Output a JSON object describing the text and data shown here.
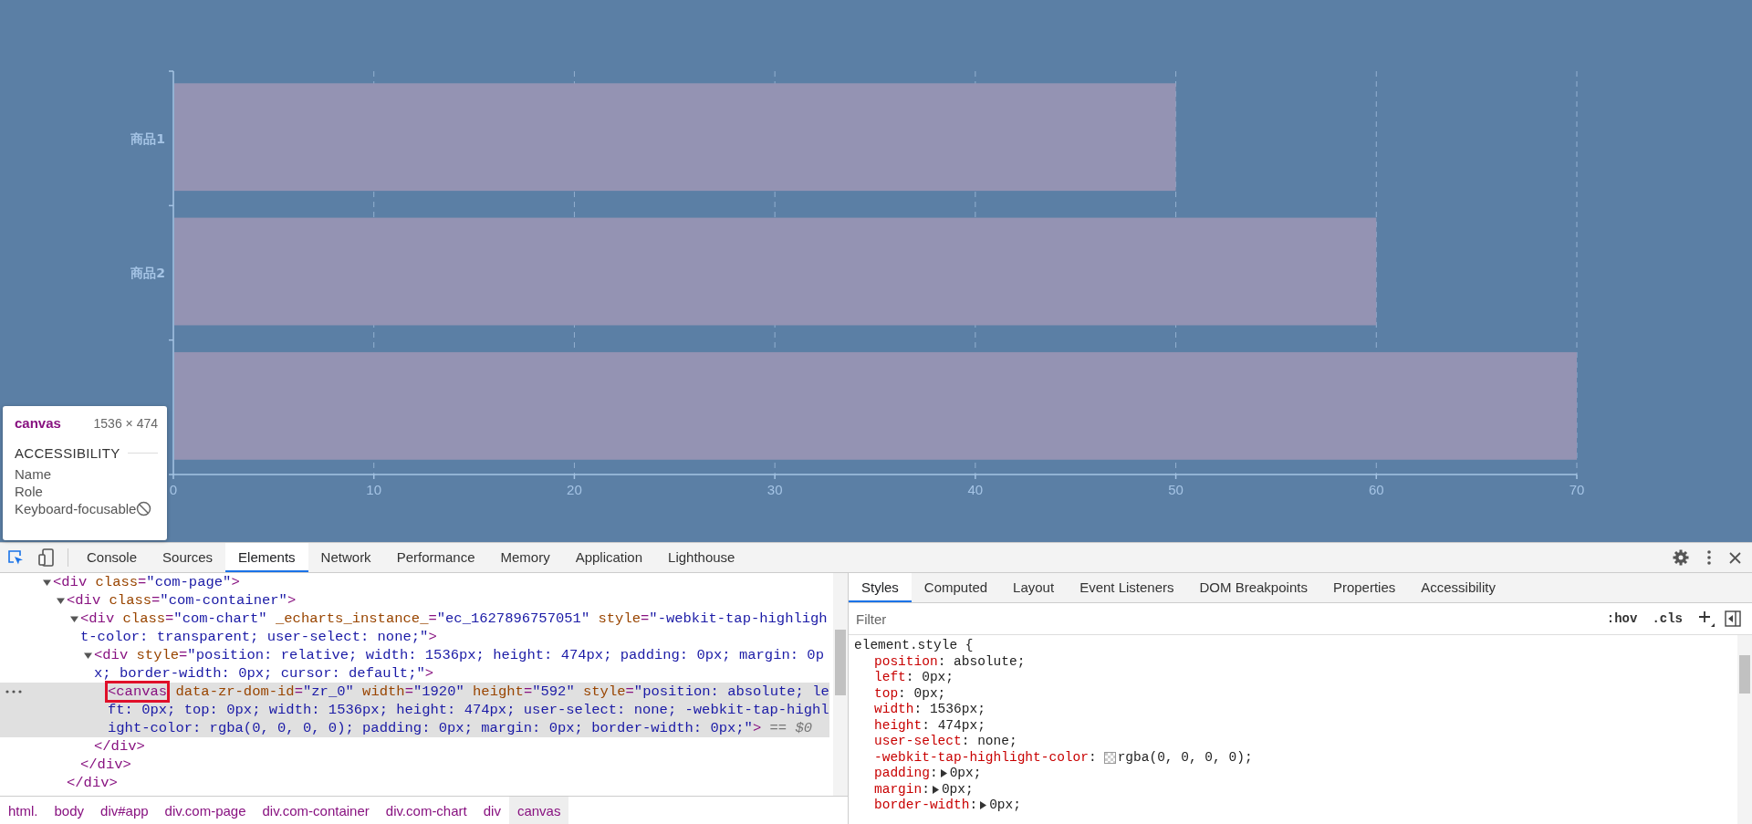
{
  "chart": {
    "chart_data": {
      "type": "bar",
      "orientation": "horizontal",
      "categories": [
        "商品1",
        "商品2",
        null
      ],
      "values": [
        50,
        60,
        70
      ],
      "xlim": [
        0,
        70
      ],
      "grid": true,
      "xticks": [
        0,
        10,
        20,
        30,
        40,
        50,
        60,
        70
      ]
    }
  },
  "inspect_tooltip": {
    "element": "canvas",
    "size": "1536 × 474",
    "section": "ACCESSIBILITY",
    "rows": [
      {
        "label": "Name",
        "kind": "plain"
      },
      {
        "label": "Role",
        "kind": "plain"
      },
      {
        "label": "Keyboard-focusable",
        "kind": "not-focusable"
      }
    ]
  },
  "devtools": {
    "tabs": [
      {
        "label": "Console",
        "selected": false
      },
      {
        "label": "Sources",
        "selected": false
      },
      {
        "label": "Elements",
        "selected": true
      },
      {
        "label": "Network",
        "selected": false
      },
      {
        "label": "Performance",
        "selected": false
      },
      {
        "label": "Memory",
        "selected": false
      },
      {
        "label": "Application",
        "selected": false
      },
      {
        "label": "Lighthouse",
        "selected": false
      }
    ],
    "inspect_mode": {
      "selected": true
    },
    "dom_tree": [
      {
        "open": "<div class=\"com-page\">",
        "expanded": true,
        "selected": false,
        "children": [
          {
            "open": "<div class=\"com-container\">",
            "expanded": true,
            "selected": false,
            "close": "</div>",
            "children": [
              {
                "open": "<div class=\"com-chart\" _echarts_instance_=\"ec_1627896757051\" style=\"-webkit-tap-highlight-color: transparent; user-select: none;\">",
                "expanded": true,
                "selected": false,
                "close": "</div>",
                "children": [
                  {
                    "open": "<div style=\"position: relative; width: 1536px; height: 474px; padding: 0px; margin: 0px; border-width: 0px; cursor: default;\">",
                    "expanded": true,
                    "selected": false,
                    "close": "</div>",
                    "children": [
                      {
                        "open": "<canvas data-zr-dom-id=\"zr_0\" width=\"1920\" height=\"592\" style=\"position: absolute; left: 0px; top: 0px; width: 1536px; height: 474px; user-select: none; -webkit-tap-highlight-color: rgba(0, 0, 0, 0); padding: 0px; margin: 0px; border-width: 0px;\">",
                        "selected": true,
                        "marked": true,
                        "ref": "== $0"
                      }
                    ]
                  }
                ]
              }
            ]
          }
        ]
      }
    ],
    "breadcrumbs": [
      {
        "label": "html.",
        "selected": false
      },
      {
        "label": "body",
        "selected": false
      },
      {
        "label": "div#app",
        "selected": false
      },
      {
        "label": "div.com-page",
        "selected": false
      },
      {
        "label": "div.com-container",
        "selected": false
      },
      {
        "label": "div.com-chart",
        "selected": false
      },
      {
        "label": "div",
        "selected": false
      },
      {
        "label": "canvas",
        "selected": true
      }
    ],
    "side_tabs": [
      {
        "label": "Styles",
        "selected": true
      },
      {
        "label": "Computed",
        "selected": false
      },
      {
        "label": "Layout",
        "selected": false
      },
      {
        "label": "Event Listeners",
        "selected": false
      },
      {
        "label": "DOM Breakpoints",
        "selected": false
      },
      {
        "label": "Properties",
        "selected": false
      },
      {
        "label": "Accessibility",
        "selected": false
      }
    ],
    "filter": {
      "placeholder": "Filter"
    },
    "filter_buttons": [
      ":hov",
      ".cls"
    ],
    "rule": {
      "selector": "element.style {",
      "declarations": [
        {
          "property": "position",
          "sep": ":",
          "value": "absolute;"
        },
        {
          "property": "left",
          "sep": ":",
          "value": "0px;"
        },
        {
          "property": "top",
          "sep": ":",
          "value": "0px;"
        },
        {
          "property": "width",
          "sep": ":",
          "value": "1536px;"
        },
        {
          "property": "height",
          "sep": ":",
          "value": "474px;"
        },
        {
          "property": "user-select",
          "sep": ":",
          "value": "none;"
        },
        {
          "property": "-webkit-tap-highlight-color",
          "sep": ":",
          "value": "rgba(0, 0, 0, 0);",
          "kind": "color"
        },
        {
          "property": "padding",
          "sep": ":",
          "value": "0px;",
          "kind": "shorthand"
        },
        {
          "property": "margin",
          "sep": ":",
          "value": "0px;",
          "kind": "shorthand"
        },
        {
          "property": "border-width",
          "sep": ":",
          "value": "0px;",
          "kind": "shorthand"
        }
      ]
    }
  }
}
